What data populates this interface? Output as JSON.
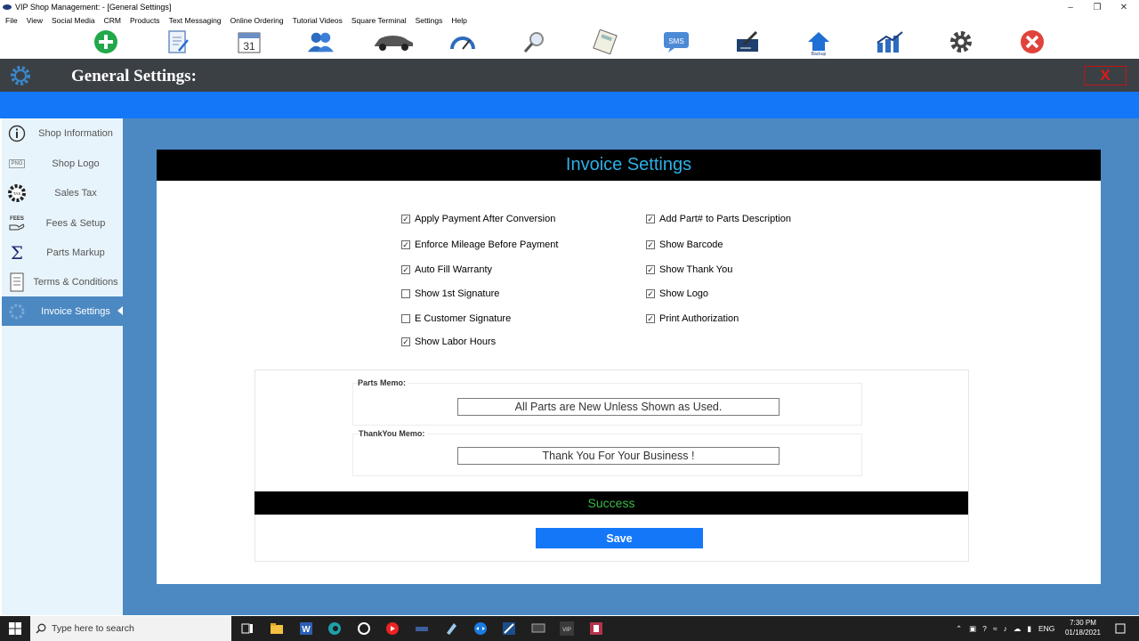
{
  "window": {
    "title": "VIP Shop Management: - [General Settings]"
  },
  "menu": [
    "File",
    "View",
    "Social Media",
    "CRM",
    "Products",
    "Text Messaging",
    "Online Ordering",
    "Tutorial Videos",
    "Square Terminal",
    "Settings",
    "Help"
  ],
  "toolbar": {
    "icons": [
      "add-icon",
      "edit-document-icon",
      "calendar-icon",
      "customers-icon",
      "car-icon",
      "speedometer-icon",
      "search-icon",
      "calculator-icon",
      "sms-icon",
      "signature-icon",
      "home-icon",
      "chart-icon",
      "settings-gear-icon",
      "exit-icon"
    ],
    "calendar_day": "31",
    "sms_text": "SMS",
    "home_caption": "Backup"
  },
  "header": {
    "title": "General Settings:",
    "close_label": "X"
  },
  "sidebar": {
    "items": [
      {
        "label": "Shop Information",
        "icon": "info-icon"
      },
      {
        "label": "Shop Logo",
        "icon": "png-icon",
        "icon_text": "PNG"
      },
      {
        "label": "Sales Tax",
        "icon": "tax-gear-icon",
        "icon_text": "TAX"
      },
      {
        "label": "Fees & Setup",
        "icon": "fees-hand-icon",
        "icon_text": "FEES"
      },
      {
        "label": "Parts Markup",
        "icon": "sigma-icon",
        "icon_text": "Σ"
      },
      {
        "label": "Terms & Conditions",
        "icon": "document-icon"
      },
      {
        "label": "Invoice Settings",
        "icon": "invoice-icon",
        "active": true
      }
    ]
  },
  "panel": {
    "title": "Invoice Settings",
    "left_options": [
      {
        "label": "Apply Payment After Conversion",
        "checked": true
      },
      {
        "label": "Enforce Mileage Before Payment",
        "checked": true
      },
      {
        "label": "Auto Fill Warranty",
        "checked": true
      },
      {
        "label": "Show 1st Signature",
        "checked": false
      },
      {
        "label": "E Customer Signature",
        "checked": false
      },
      {
        "label": "Show Labor Hours",
        "checked": true
      }
    ],
    "right_options": [
      {
        "label": "Add Part# to Parts Description",
        "checked": true
      },
      {
        "label": "Show Barcode",
        "checked": true
      },
      {
        "label": "Show Thank You",
        "checked": true
      },
      {
        "label": "Show Logo",
        "checked": true
      },
      {
        "label": "Print Authorization",
        "checked": true
      }
    ],
    "parts_memo": {
      "label": "Parts Memo:",
      "value": "All Parts are New Unless Shown as Used."
    },
    "thankyou_memo": {
      "label": "ThankYou Memo:",
      "value": "Thank You For Your Business !"
    },
    "status": "Success",
    "save_label": "Save"
  },
  "taskbar": {
    "search_placeholder": "Type here to search",
    "language": "ENG",
    "time": "7:30 PM",
    "date": "01/18/2021"
  },
  "colors": {
    "accent_blue": "#1477f8",
    "content_bg": "#4c89c3",
    "title_cyan": "#2db0e8",
    "success_green": "#3bb94a",
    "close_red": "#e01818"
  }
}
